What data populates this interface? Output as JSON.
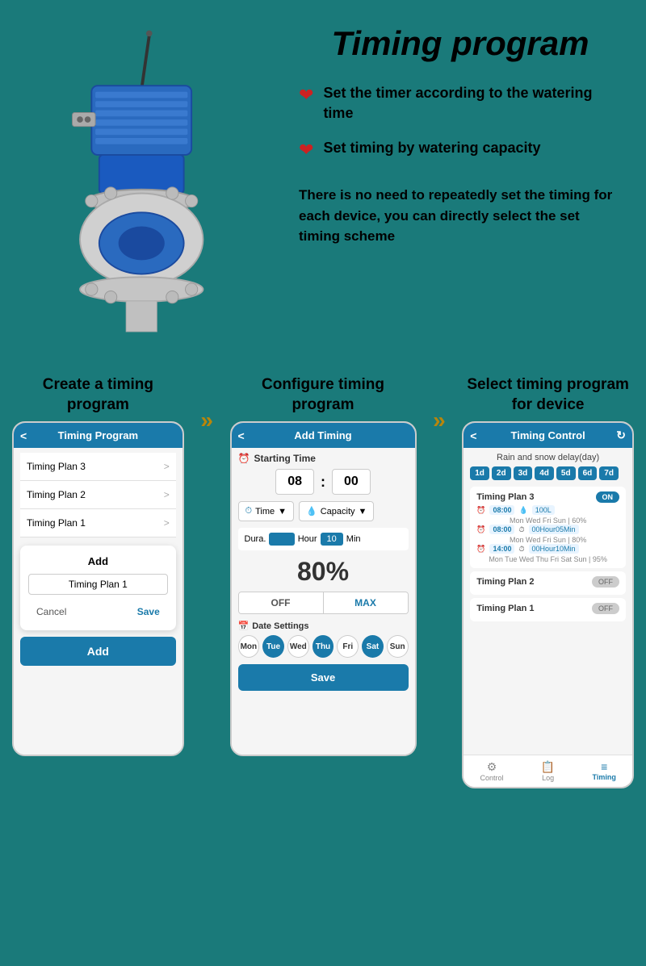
{
  "page": {
    "title": "Timing program",
    "background": "#1a7a7a"
  },
  "features": [
    {
      "id": "f1",
      "icon": "heart",
      "text": "Set the timer according to the watering time"
    },
    {
      "id": "f2",
      "icon": "heart",
      "text": "Set timing by watering capacity"
    }
  ],
  "description": "There is no need to repeatedly set the timing for each device, you can directly select the set timing scheme",
  "steps": [
    {
      "id": "step1",
      "title": "Create a timing program",
      "phone": {
        "header": "Timing Program",
        "items": [
          "Timing Plan 3",
          "Timing Plan 2",
          "Timing Plan 1"
        ],
        "dialog": {
          "add_label": "Add",
          "input_value": "Timing Plan 1",
          "cancel": "Cancel",
          "save": "Save"
        },
        "bottom_btn": "Add"
      }
    },
    {
      "id": "step2",
      "title": "Configure timing program",
      "phone": {
        "header": "Add Timing",
        "starting_time_label": "Starting Time",
        "hour": "08",
        "minute": "00",
        "time_selector": "Time",
        "capacity_selector": "Capacity",
        "dura_label": "Dura.",
        "hour_label": "Hour",
        "min_value": "10",
        "min_label": "Min",
        "percent": "80%",
        "off_label": "OFF",
        "max_label": "MAX",
        "date_label": "Date Settings",
        "days": [
          {
            "label": "Mon",
            "active": false
          },
          {
            "label": "Tue",
            "active": true
          },
          {
            "label": "Wed",
            "active": false
          },
          {
            "label": "Thu",
            "active": true
          },
          {
            "label": "Fri",
            "active": false
          },
          {
            "label": "Sat",
            "active": true
          },
          {
            "label": "Sun",
            "active": false
          }
        ],
        "save_btn": "Save"
      }
    },
    {
      "id": "step3",
      "title": "Select timing program for device",
      "phone": {
        "header": "Timing Control",
        "delay_label": "Rain and snow delay(day)",
        "day_btns": [
          "1d",
          "2d",
          "3d",
          "4d",
          "5d",
          "6d",
          "7d"
        ],
        "plans": [
          {
            "name": "Timing Plan 3",
            "toggle": "ON",
            "active": true,
            "timings": [
              {
                "time": "08:00",
                "cap": "100L",
                "days": "Mon Wed Fri Sun | 60%"
              },
              {
                "time": "08:00",
                "cap": "00Hour05Min",
                "days": "Mon Wed Fri Sun | 80%"
              },
              {
                "time": "14:00",
                "cap": "00Hour10Min",
                "days": "Mon Tue Wed Thu Fri Sat Sun | 95%"
              }
            ]
          },
          {
            "name": "Timing Plan 2",
            "toggle": "OFF",
            "active": false,
            "timings": []
          },
          {
            "name": "Timing Plan 1",
            "toggle": "OFF",
            "active": false,
            "timings": []
          }
        ],
        "nav": [
          {
            "label": "Control",
            "icon": "⚙",
            "active": false
          },
          {
            "label": "Log",
            "icon": "📋",
            "active": false
          },
          {
            "label": "Timing",
            "icon": "≡",
            "active": true
          }
        ]
      }
    }
  ],
  "arrows": [
    "»",
    "»"
  ]
}
